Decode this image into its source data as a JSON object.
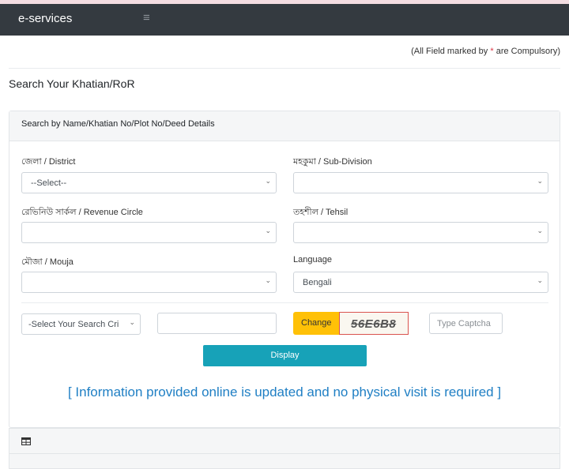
{
  "navbar": {
    "brand": "e-services",
    "menu_icon": "hamburger-icon"
  },
  "notice": {
    "prefix": "(All Field marked by ",
    "star": "*",
    "suffix": " are Compulsory)"
  },
  "page_title": "Search Your Khatian/RoR",
  "search_card": {
    "header": "Search by Name/Khatian No/Plot No/Deed Details",
    "fields": {
      "district": {
        "label": "জেলা / District",
        "value": "--Select--"
      },
      "subdivision": {
        "label": "মহকুমা / Sub-Division",
        "value": ""
      },
      "revenue_circle": {
        "label": "রেভিনিউ সার্কল / Revenue Circle",
        "value": ""
      },
      "tehsil": {
        "label": "তহশীল / Tehsil",
        "value": ""
      },
      "mouja": {
        "label": "মৌজা / Mouja",
        "value": ""
      },
      "language": {
        "label": "Language",
        "value": "Bengali"
      }
    },
    "criteria": {
      "value": "-Select Your Search Cri"
    },
    "search_text": {
      "value": ""
    },
    "captcha": {
      "change_label": "Change",
      "code": "56E6B8",
      "placeholder": "Type Captcha"
    },
    "display_label": "Display",
    "info": "[ Information provided online is updated and no physical visit is required ]"
  },
  "results_card": {
    "icon": "table-icon"
  },
  "colors": {
    "navbar": "#343a40",
    "accent_button": "#17a2b8",
    "change_button": "#ffc107",
    "info_text": "#1f7fc4",
    "required_star": "#dc3545"
  }
}
